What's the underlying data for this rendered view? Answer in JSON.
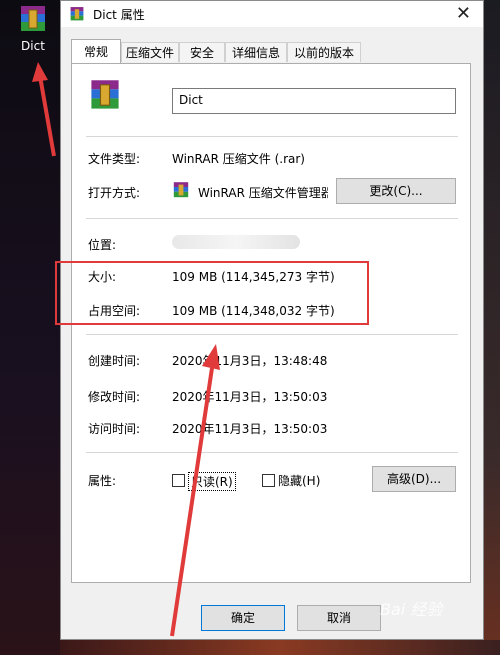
{
  "desktop": {
    "icon_label": "Dict"
  },
  "window": {
    "title": "Dict 属性",
    "close_glyph": "✕"
  },
  "tabs": [
    {
      "label": "常规",
      "active": true
    },
    {
      "label": "压缩文件"
    },
    {
      "label": "安全"
    },
    {
      "label": "详细信息"
    },
    {
      "label": "以前的版本"
    }
  ],
  "general": {
    "file_name": "Dict",
    "file_type_label": "文件类型:",
    "file_type_value": "WinRAR 压缩文件 (.rar)",
    "open_with_label": "打开方式:",
    "open_with_value": "WinRAR 压缩文件管理器",
    "change_button": "更改(C)...",
    "location_label": "位置:",
    "size_label": "大小:",
    "size_value": "109 MB (114,345,273 字节)",
    "disk_size_label": "占用空间:",
    "disk_size_value": "109 MB (114,348,032 字节)",
    "created_label": "创建时间:",
    "created_value": "2020年11月3日，13:48:48",
    "modified_label": "修改时间:",
    "modified_value": "2020年11月3日，13:50:03",
    "accessed_label": "访问时间:",
    "accessed_value": "2020年11月3日，13:50:03",
    "attributes_label": "属性:",
    "readonly_label": "只读(R)",
    "hidden_label": "隐藏(H)",
    "advanced_button": "高级(D)..."
  },
  "footer": {
    "ok_button": "确定",
    "cancel_button": "取消"
  },
  "watermark": "Bai 经验",
  "colors": {
    "annotation_red": "#e03a3a",
    "focus_blue": "#0078d7"
  }
}
